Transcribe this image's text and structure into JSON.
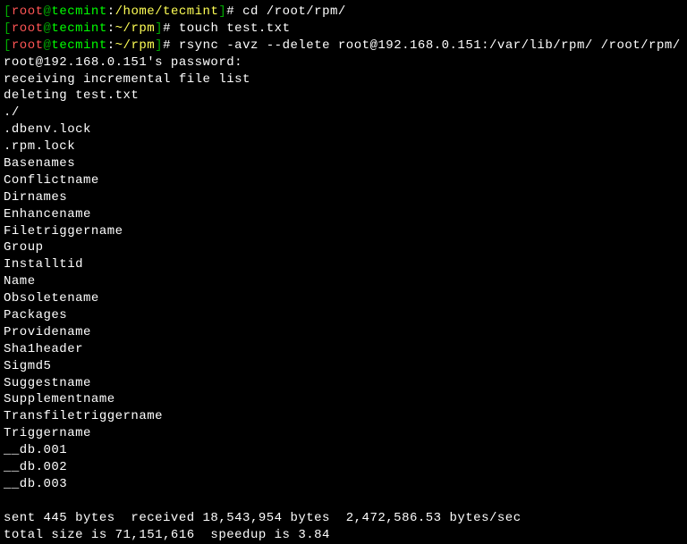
{
  "prompts": [
    {
      "open": "[",
      "user": "root",
      "at": "@",
      "host": "tecmint",
      "colon": ":",
      "path": "/home/tecmint",
      "close": "]",
      "hash": "#",
      "command": " cd /root/rpm/"
    },
    {
      "open": "[",
      "user": "root",
      "at": "@",
      "host": "tecmint",
      "colon": ":",
      "path": "~/rpm",
      "close": "]",
      "hash": "#",
      "command": " touch test.txt"
    },
    {
      "open": "[",
      "user": "root",
      "at": "@",
      "host": "tecmint",
      "colon": ":",
      "path": "~/rpm",
      "close": "]",
      "hash": "#",
      "command": " rsync -avz --delete root@192.168.0.151:/var/lib/rpm/ /root/rpm/"
    }
  ],
  "output_lines": [
    "root@192.168.0.151's password:",
    "receiving incremental file list",
    "deleting test.txt",
    "./",
    ".dbenv.lock",
    ".rpm.lock",
    "Basenames",
    "Conflictname",
    "Dirnames",
    "Enhancename",
    "Filetriggername",
    "Group",
    "Installtid",
    "Name",
    "Obsoletename",
    "Packages",
    "Providename",
    "Sha1header",
    "Sigmd5",
    "Suggestname",
    "Supplementname",
    "Transfiletriggername",
    "Triggername",
    "__db.001",
    "__db.002",
    "__db.003",
    "",
    "sent 445 bytes  received 18,543,954 bytes  2,472,586.53 bytes/sec",
    "total size is 71,151,616  speedup is 3.84"
  ]
}
